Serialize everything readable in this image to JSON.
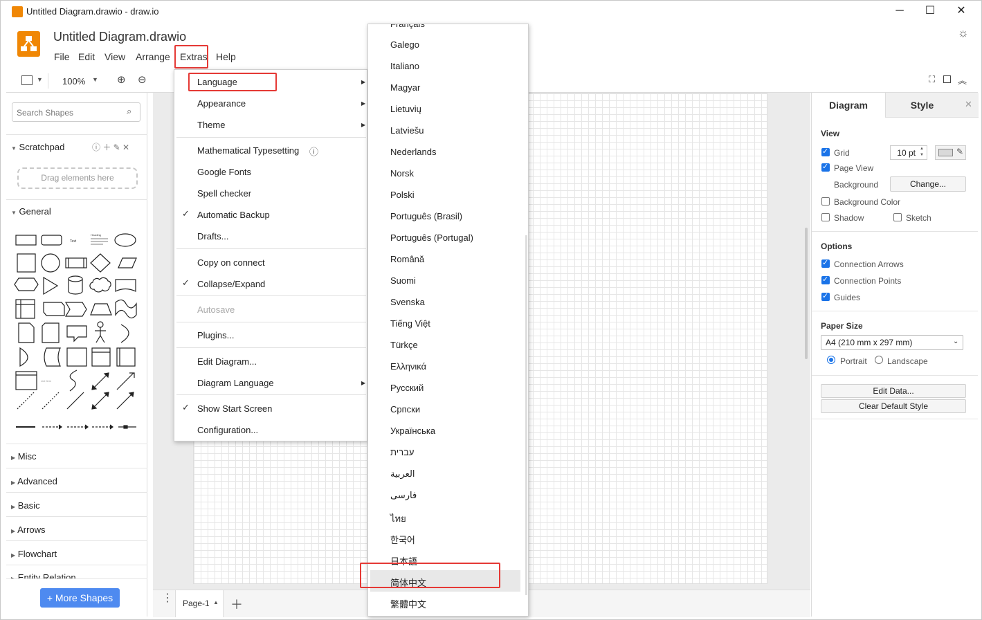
{
  "window": {
    "title": "Untitled Diagram.drawio - draw.io",
    "controls": [
      "─",
      "☐",
      "✕"
    ]
  },
  "header": {
    "doc_title": "Untitled Diagram.drawio",
    "menus": [
      "File",
      "Edit",
      "View",
      "Arrange",
      "Extras",
      "Help"
    ]
  },
  "toolbar": {
    "zoom": "100%"
  },
  "left": {
    "search_placeholder": "Search Shapes",
    "scratchpad": "Scratchpad",
    "drag_hint": "Drag elements here",
    "general": "General",
    "sections": [
      "Misc",
      "Advanced",
      "Basic",
      "Arrows",
      "Flowchart",
      "Entity Relation"
    ],
    "more_shapes": "+ More Shapes",
    "shape_text": "Text",
    "shape_heading": "Heading"
  },
  "pagebar": {
    "page": "Page-1"
  },
  "right": {
    "tabs": [
      "Diagram",
      "Style"
    ],
    "view_title": "View",
    "grid": "Grid",
    "grid_size": "10 pt",
    "page_view": "Page View",
    "background": "Background",
    "change": "Change...",
    "background_color": "Background Color",
    "shadow": "Shadow",
    "sketch": "Sketch",
    "options_title": "Options",
    "connection_arrows": "Connection Arrows",
    "connection_points": "Connection Points",
    "guides": "Guides",
    "paper_title": "Paper Size",
    "paper_value": "A4 (210 mm x 297 mm)",
    "portrait": "Portrait",
    "landscape": "Landscape",
    "edit_data": "Edit Data...",
    "clear_style": "Clear Default Style"
  },
  "extras_menu": {
    "language": "Language",
    "appearance": "Appearance",
    "theme": "Theme",
    "math": "Mathematical Typesetting",
    "google_fonts": "Google Fonts",
    "spell": "Spell checker",
    "autobackup": "Automatic Backup",
    "drafts": "Drafts...",
    "copy_on_connect": "Copy on connect",
    "collapse": "Collapse/Expand",
    "autosave": "Autosave",
    "plugins": "Plugins...",
    "edit_diagram": "Edit Diagram...",
    "diagram_language": "Diagram Language",
    "start_screen": "Show Start Screen",
    "configuration": "Configuration..."
  },
  "language_menu": {
    "items": [
      "Français",
      "Galego",
      "Italiano",
      "Magyar",
      "Lietuvių",
      "Latviešu",
      "Nederlands",
      "Norsk",
      "Polski",
      "Português (Brasil)",
      "Português (Portugal)",
      "Română",
      "Suomi",
      "Svenska",
      "Tiếng Việt",
      "Türkçe",
      "Ελληνικά",
      "Русский",
      "Српски",
      "Українська",
      "עברית",
      "العربية",
      "فارسی",
      "ไทย",
      "한국어",
      "日本語",
      "简体中文",
      "繁體中文"
    ]
  },
  "colors": {
    "accent": "#f08705",
    "highlight": "#e53935",
    "primary": "#1a73e8"
  }
}
